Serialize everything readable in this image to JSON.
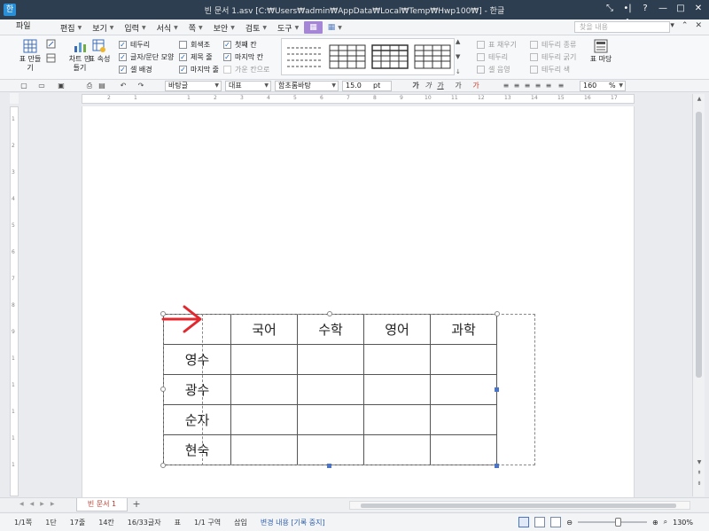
{
  "window": {
    "title": "빈 문서 1.asv [C:₩Users₩admin₩AppData₩Local₩Temp₩Hwp100₩] - 한글",
    "app_icon": "한"
  },
  "menu": {
    "file": "파일",
    "items": [
      {
        "label": "편집"
      },
      {
        "label": "보기"
      },
      {
        "label": "입력"
      },
      {
        "label": "서식"
      },
      {
        "label": "쪽"
      },
      {
        "label": "보안"
      },
      {
        "label": "검토"
      },
      {
        "label": "도구"
      }
    ],
    "search_placeholder": "찾을 내용"
  },
  "ribbon": {
    "table_btn": "표 만들기",
    "chart_btn": "차트 만들기",
    "props_btn": "표 속성",
    "checks": [
      {
        "label": "테두리",
        "checked": true
      },
      {
        "label": "글자/문단 모양",
        "checked": true
      },
      {
        "label": "셀 배경",
        "checked": true
      },
      {
        "label": "회색조",
        "checked": false
      },
      {
        "label": "제목 줄",
        "checked": true
      },
      {
        "label": "마지막 줄",
        "checked": true
      },
      {
        "label": "첫째 칸",
        "checked": true
      },
      {
        "label": "마지막 칸",
        "checked": true
      }
    ],
    "apply_label": "가운 칸으로",
    "right_tools": [
      {
        "label": "표 채우기"
      },
      {
        "label": "테두리"
      },
      {
        "label": "셀 음영"
      },
      {
        "label": "테두리 종류"
      },
      {
        "label": "테두리 굵기"
      },
      {
        "label": "테두리 색"
      }
    ],
    "background_btn": "표 마당"
  },
  "format": {
    "style": "바탕글",
    "lang": "대표",
    "font": "함초롬바탕",
    "size": "15.0",
    "unit": "pt",
    "zoom": "160",
    "zoom_unit": "%"
  },
  "table": {
    "header": [
      "",
      "국어",
      "수학",
      "영어",
      "과학"
    ],
    "rows": [
      [
        "영수",
        "",
        "",
        "",
        ""
      ],
      [
        "광수",
        "",
        "",
        "",
        ""
      ],
      [
        "순자",
        "",
        "",
        "",
        ""
      ],
      [
        "현숙",
        "",
        "",
        "",
        ""
      ]
    ]
  },
  "tabs": {
    "doc_tab": "빈 문서 1"
  },
  "status": {
    "page": "1/1쪽",
    "column": "1단",
    "line": "17줄",
    "col": "14칸",
    "chars": "16/33글자",
    "mode": "표",
    "section": "1/1 구역",
    "insert": "삽입",
    "change": "변경 내용 [기록 중지]",
    "zoom": "130%"
  }
}
